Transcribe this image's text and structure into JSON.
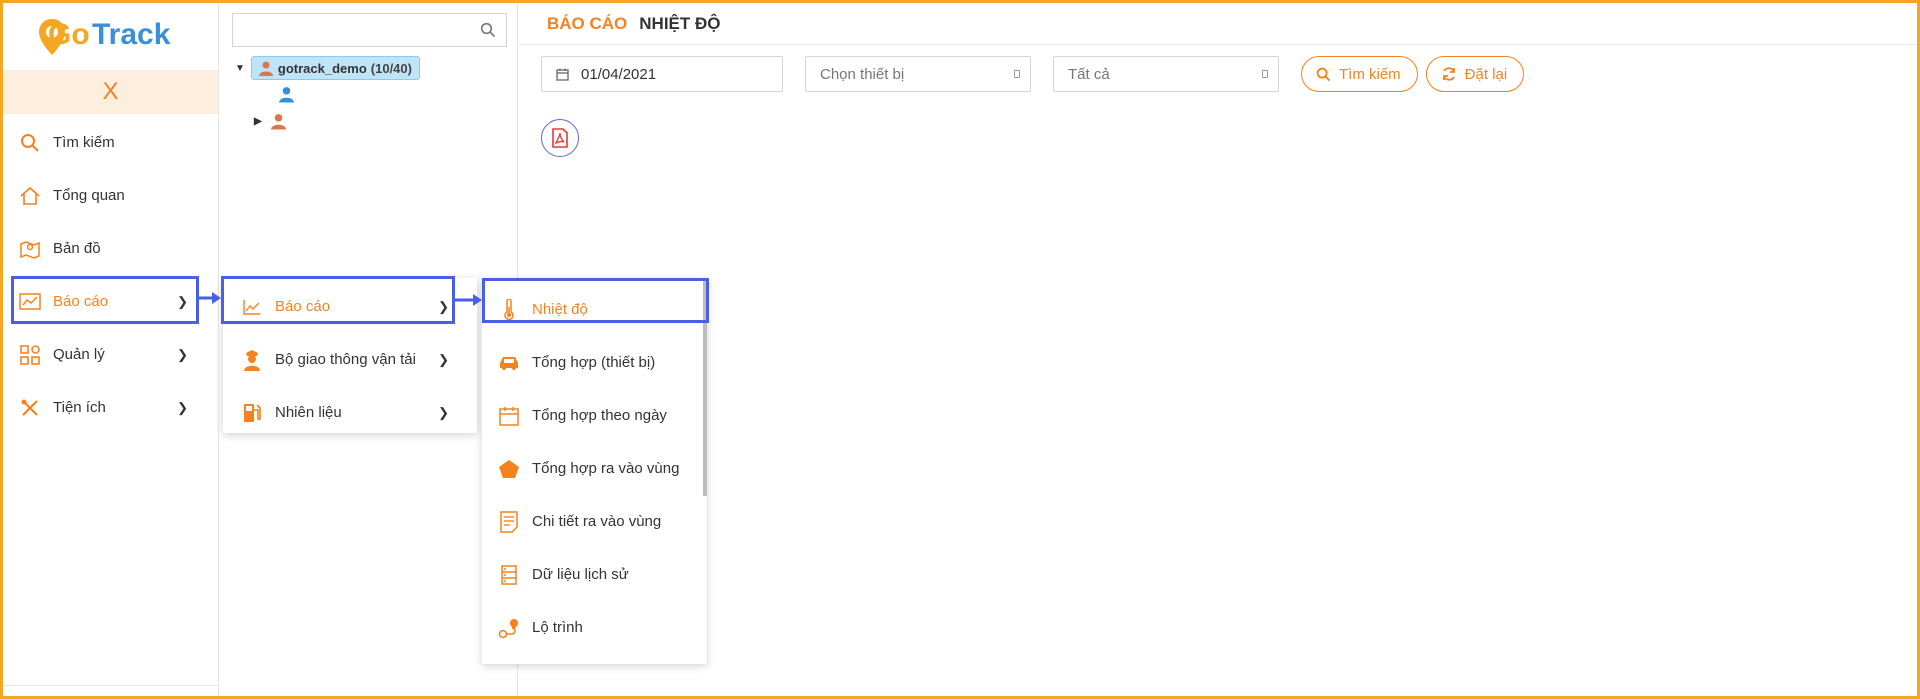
{
  "logo": {
    "text_go": "Go",
    "text_track": "Track"
  },
  "sidebar": {
    "close_label": "X",
    "items": [
      {
        "label": "Tìm kiếm",
        "icon": "search-icon",
        "has_submenu": false
      },
      {
        "label": "Tổng quan",
        "icon": "home-icon",
        "has_submenu": false
      },
      {
        "label": "Bản đồ",
        "icon": "map-icon",
        "has_submenu": false
      },
      {
        "label": "Báo cáo",
        "icon": "chart-icon",
        "has_submenu": true,
        "active": true
      },
      {
        "label": "Quản lý",
        "icon": "grid-icon",
        "has_submenu": true
      },
      {
        "label": "Tiện ích",
        "icon": "tools-icon",
        "has_submenu": true
      }
    ]
  },
  "tree": {
    "search_placeholder": "",
    "root_label": "gotrack_demo",
    "root_count": "(10/40)"
  },
  "header": {
    "section": "BÁO CÁO",
    "page": "NHIỆT ĐỘ"
  },
  "filters": {
    "date_value": "01/04/2021",
    "device_placeholder": "Chọn thiết bị",
    "status_value": "Tất cả",
    "search_label": "Tìm kiếm",
    "reset_label": "Đặt lại"
  },
  "submenu_level1": [
    {
      "label": "Báo cáo",
      "icon": "line-chart-icon"
    },
    {
      "label": "Bộ giao thông vận tải",
      "icon": "officer-icon"
    },
    {
      "label": "Nhiên liệu",
      "icon": "fuel-icon"
    }
  ],
  "submenu_level2": [
    {
      "label": "Nhiệt độ",
      "icon": "thermometer-icon"
    },
    {
      "label": "Tổng hợp (thiết bị)",
      "icon": "car-icon"
    },
    {
      "label": "Tổng hợp theo ngày",
      "icon": "calendar-icon"
    },
    {
      "label": "Tổng hợp ra vào vùng",
      "icon": "pentagon-icon"
    },
    {
      "label": "Chi tiết ra vào vùng",
      "icon": "document-icon"
    },
    {
      "label": "Dữ liệu lịch sử",
      "icon": "database-icon"
    },
    {
      "label": "Lộ trình",
      "icon": "route-icon"
    }
  ],
  "colors": {
    "accent": "#f5821f",
    "highlight": "#4a5ee8",
    "frame": "#f5a623"
  }
}
